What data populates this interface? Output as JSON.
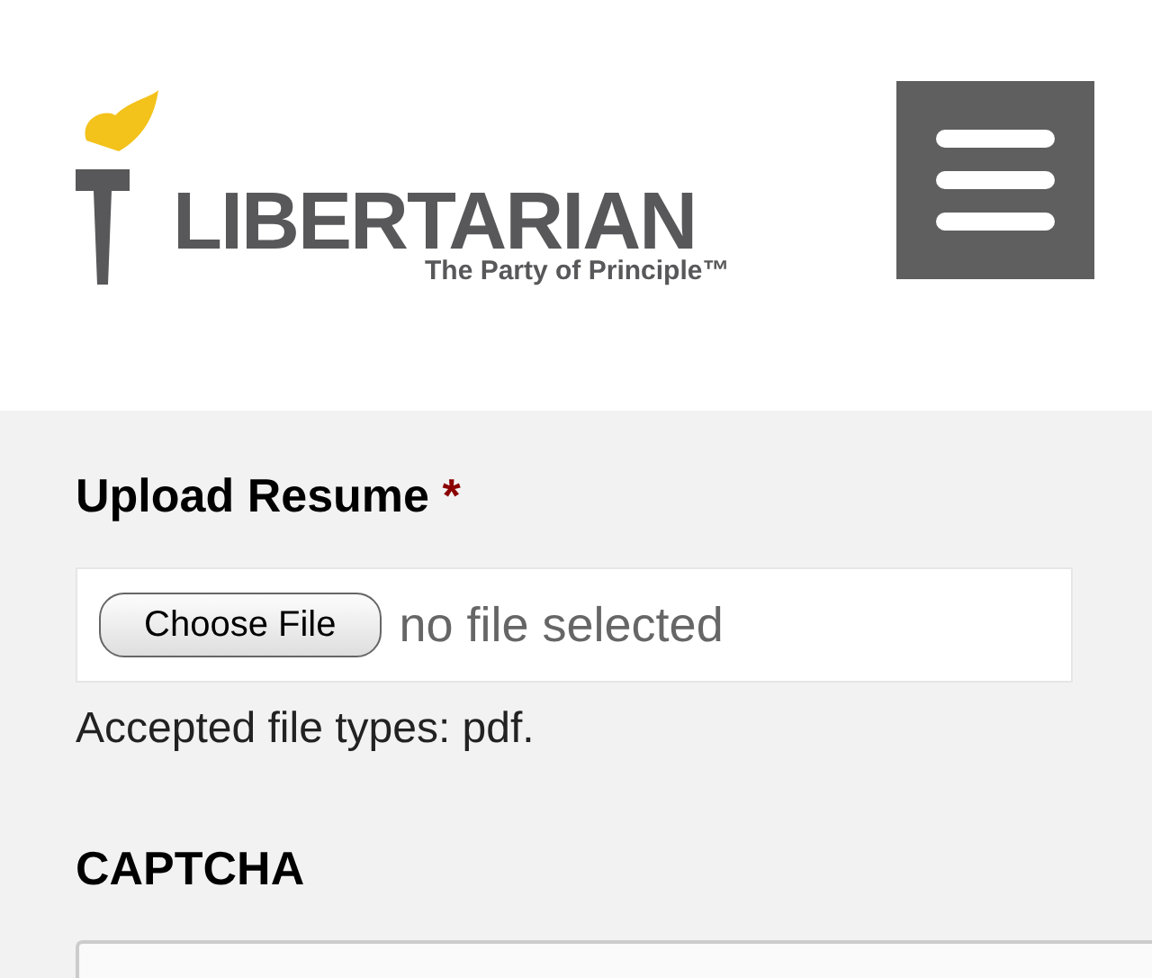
{
  "header": {
    "logo": {
      "name": "LIBERTARIAN",
      "tagline": "The Party of Principle™"
    }
  },
  "upload": {
    "label": "Upload Resume",
    "required": true,
    "required_mark": "*",
    "button": "Choose File",
    "status": "no file selected",
    "help": "Accepted file types: pdf."
  },
  "captcha": {
    "label": "CAPTCHA"
  }
}
